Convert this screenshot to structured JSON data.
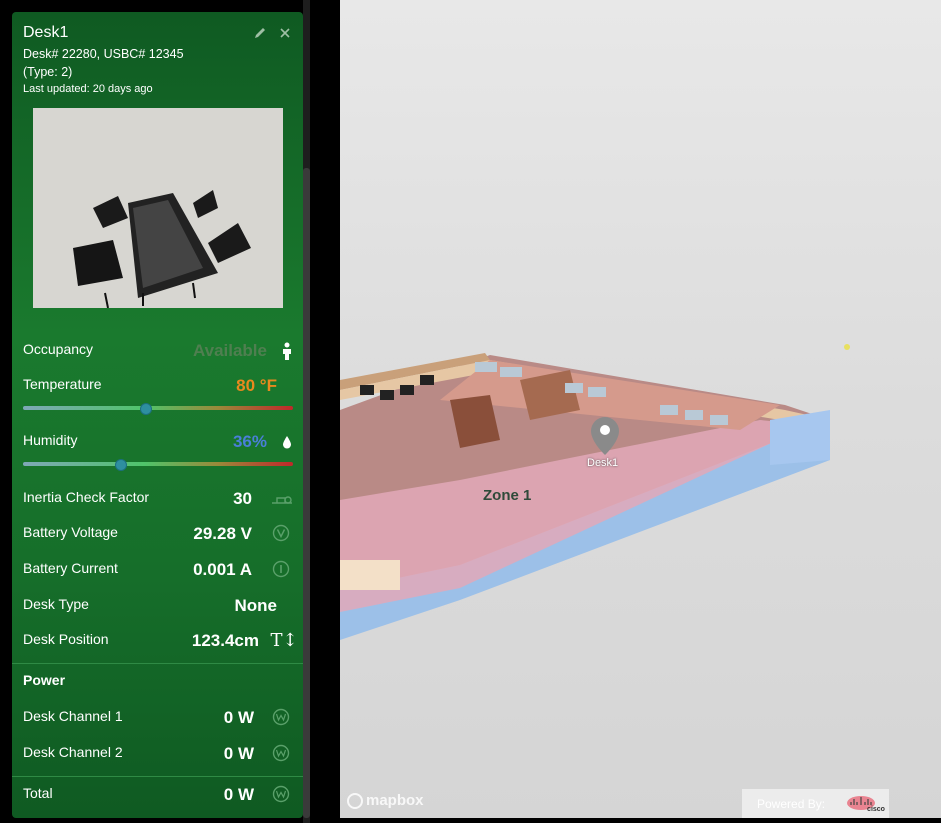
{
  "panel": {
    "title": "Desk1",
    "ids": "Desk# 22280, USBC# 12345",
    "type": "(Type: 2)",
    "last_updated": "Last updated: 20 days ago",
    "edit_icon": "pencil-icon",
    "close_icon": "close-icon"
  },
  "metrics": {
    "occupancy": {
      "label": "Occupancy",
      "value": "Available",
      "icon": "person-icon"
    },
    "temperature": {
      "label": "Temperature",
      "value": "80 °F",
      "slider_level": 0.45,
      "color": "#e8891e"
    },
    "humidity": {
      "label": "Humidity",
      "value": "36%",
      "slider_level": 0.36,
      "color": "#4a7fd8",
      "icon": "droplet-icon"
    },
    "inertia": {
      "label": "Inertia Check Factor",
      "value": "30",
      "icon": "inertia-icon"
    },
    "battery_voltage": {
      "label": "Battery Voltage",
      "value": "29.28 V",
      "icon": "voltage-icon"
    },
    "battery_current": {
      "label": "Battery Current",
      "value": "0.001 A",
      "icon": "current-icon"
    },
    "desk_type": {
      "label": "Desk Type",
      "value": "None"
    },
    "desk_position": {
      "label": "Desk Position",
      "value": "123.4cm",
      "icon": "height-icon"
    }
  },
  "power": {
    "heading": "Power",
    "channel1": {
      "label": "Desk Channel 1",
      "value": "0 W",
      "icon": "watt-icon"
    },
    "channel2": {
      "label": "Desk Channel 2",
      "value": "0 W",
      "icon": "watt-icon"
    },
    "total": {
      "label": "Total",
      "value": "0 W",
      "icon": "watt-icon"
    }
  },
  "map": {
    "marker_label": "Desk1",
    "zone_label": "Zone 1",
    "attribution": "mapbox",
    "powered_by": "Powered By:",
    "brand": "cisco"
  }
}
